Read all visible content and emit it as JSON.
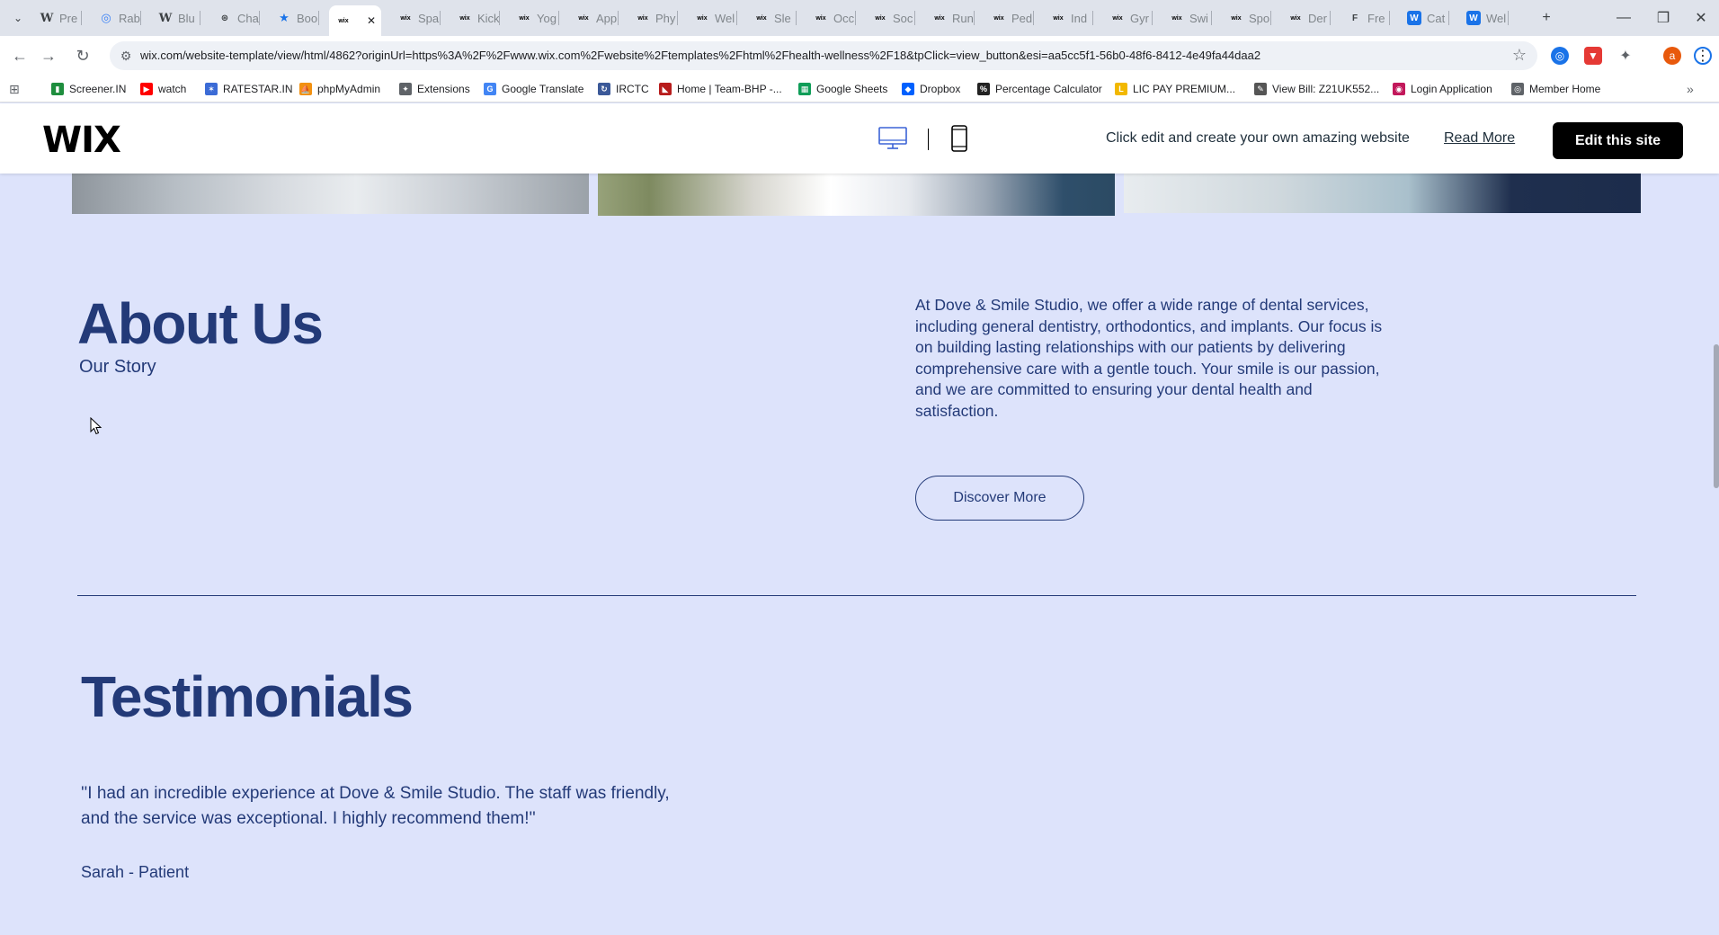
{
  "browser": {
    "tabs": [
      {
        "label": "Pre",
        "icon": "wikipedia-icon"
      },
      {
        "label": "Rab",
        "icon": "globe-icon"
      },
      {
        "label": "Blu",
        "icon": "wikipedia-icon"
      },
      {
        "label": "Cha",
        "icon": "openai-icon"
      },
      {
        "label": "Boo",
        "icon": "bookmark-star-icon"
      },
      {
        "label": "",
        "icon": "wix-icon",
        "active": true
      },
      {
        "label": "Spa",
        "icon": "wix-icon"
      },
      {
        "label": "Kick",
        "icon": "wix-icon"
      },
      {
        "label": "Yog",
        "icon": "wix-icon"
      },
      {
        "label": "App",
        "icon": "wix-icon"
      },
      {
        "label": "Phy",
        "icon": "wix-icon"
      },
      {
        "label": "Wel",
        "icon": "wix-icon"
      },
      {
        "label": "Sle",
        "icon": "wix-icon"
      },
      {
        "label": "Occ",
        "icon": "wix-icon"
      },
      {
        "label": "Soc",
        "icon": "wix-icon"
      },
      {
        "label": "Run",
        "icon": "wix-icon"
      },
      {
        "label": "Ped",
        "icon": "wix-icon"
      },
      {
        "label": "Ind",
        "icon": "wix-icon"
      },
      {
        "label": "Gyr",
        "icon": "wix-icon"
      },
      {
        "label": "Swi",
        "icon": "wix-icon"
      },
      {
        "label": "Spo",
        "icon": "wix-icon"
      },
      {
        "label": "Der",
        "icon": "wix-icon"
      },
      {
        "label": "Fre",
        "icon": "framer-icon"
      },
      {
        "label": "Cat",
        "icon": "w-icon"
      },
      {
        "label": "Wel",
        "icon": "w-icon"
      }
    ],
    "active_tab_close": "✕",
    "new_tab": "+",
    "window_controls": {
      "minimize": "—",
      "restore": "❐",
      "close": "✕"
    },
    "url": "wix.com/website-template/view/html/4862?originUrl=https%3A%2F%2Fwww.wix.com%2Fwebsite%2Ftemplates%2Fhtml%2Fhealth-wellness%2F18&tpClick=view_button&esi=aa5cc5f1-56b0-48f6-8412-4e49fa44daa2",
    "profile_initial": "a",
    "bookmarks": [
      {
        "label": "Screener.IN",
        "icon": "chart-icon",
        "color": "#1e8e3e"
      },
      {
        "label": "watch",
        "icon": "youtube-icon",
        "color": "#ff0000"
      },
      {
        "label": "RATESTAR.IN",
        "icon": "ratestar-icon",
        "color": "#3b6bd6"
      },
      {
        "label": "phpMyAdmin",
        "icon": "phpmyadmin-icon",
        "color": "#f29111"
      },
      {
        "label": "Extensions",
        "icon": "puzzle-icon",
        "color": "#5f6368"
      },
      {
        "label": "Google Translate",
        "icon": "translate-icon",
        "color": "#4285f4"
      },
      {
        "label": "IRCTC",
        "icon": "irctc-icon",
        "color": "#3b5998"
      },
      {
        "label": "Home | Team-BHP -...",
        "icon": "teambhp-icon",
        "color": "#b71c1c"
      },
      {
        "label": "Google Sheets",
        "icon": "sheets-icon",
        "color": "#0f9d58"
      },
      {
        "label": "Dropbox",
        "icon": "dropbox-icon",
        "color": "#0061fe"
      },
      {
        "label": "Percentage Calculator",
        "icon": "percent-icon",
        "color": "#222222"
      },
      {
        "label": "LIC PAY PREMIUM...",
        "icon": "lic-icon",
        "color": "#f2b800"
      },
      {
        "label": "View Bill: Z21UK552...",
        "icon": "bill-icon",
        "color": "#555555"
      },
      {
        "label": "Login Application",
        "icon": "login-icon",
        "color": "#c2185b"
      },
      {
        "label": "Member Home",
        "icon": "globe-icon",
        "color": "#5f6368"
      }
    ]
  },
  "wixbar": {
    "logo": "WIX",
    "promo_text": "Click edit and create your own amazing website",
    "read_more": "Read More",
    "edit_button": "Edit this site"
  },
  "about": {
    "title": "About Us",
    "subtitle": "Our Story",
    "body": "At Dove & Smile Studio, we offer a wide range of dental services, including general dentistry, orthodontics, and implants. Our focus is on building lasting relationships with our patients by delivering comprehensive care with a gentle touch. Your smile is our passion, and we are committed to ensuring your dental health and satisfaction.",
    "button": "Discover More"
  },
  "testimonials": {
    "title": "Testimonials",
    "quote": "''I had an incredible experience at Dove & Smile Studio. The staff was friendly, and the service was exceptional. I highly recommend them!''",
    "author": "Sarah - Patient"
  },
  "colors": {
    "page_bg": "#dde3fb",
    "heading": "#233a78",
    "edit_button_bg": "#000000"
  }
}
